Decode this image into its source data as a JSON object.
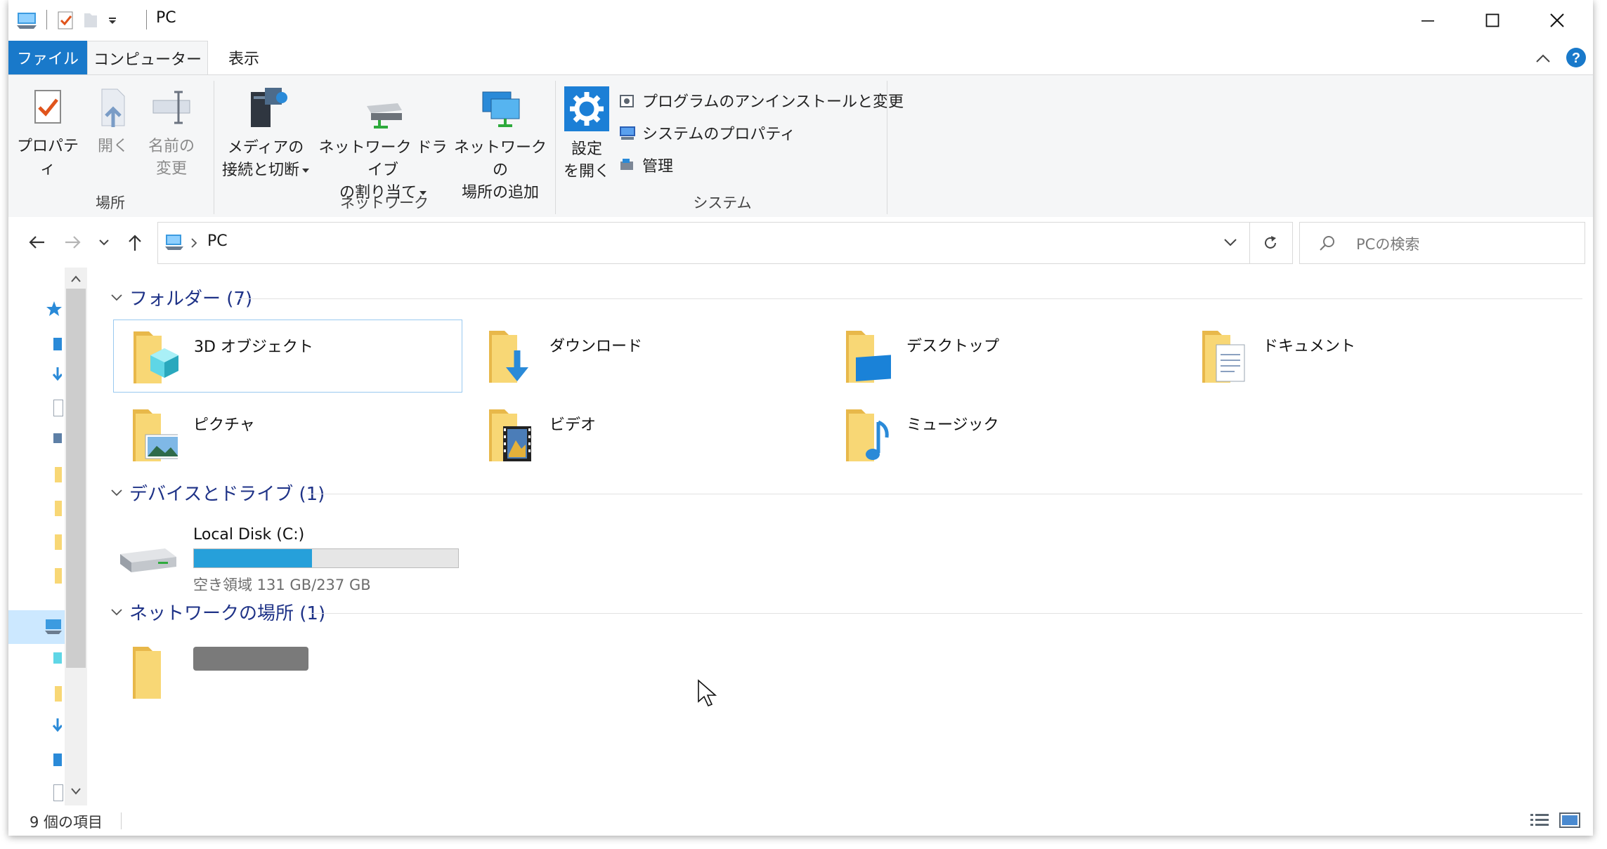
{
  "window": {
    "title": "PC"
  },
  "tabs": {
    "file": "ファイル",
    "computer": "コンピューター",
    "view": "表示"
  },
  "ribbon": {
    "location": {
      "label": "場所",
      "properties": "プロパティ",
      "open": "開く",
      "rename_line1": "名前の",
      "rename_line2": "変更"
    },
    "network": {
      "label": "ネットワーク",
      "media_line1": "メディアの",
      "media_line2": "接続と切断",
      "map_line1": "ネットワーク ドライブ",
      "map_line2": "の割り当て",
      "add_line1": "ネットワークの",
      "add_line2": "場所の追加"
    },
    "system": {
      "label": "システム",
      "settings_line1": "設定",
      "settings_line2": "を開く",
      "uninstall": "プログラムのアンインストールと変更",
      "sys_props": "システムのプロパティ",
      "manage": "管理"
    }
  },
  "address": {
    "path": "PC",
    "search_placeholder": "PCの検索"
  },
  "groups": {
    "folders": {
      "header": "フォルダー (7)",
      "items": [
        "3D オブジェクト",
        "ダウンロード",
        "デスクトップ",
        "ドキュメント",
        "ピクチャ",
        "ビデオ",
        "ミュージック"
      ]
    },
    "devices": {
      "header": "デバイスとドライブ (1)",
      "drive": {
        "name": "Local Disk (C:)",
        "free_text": "空き領域 131 GB/237 GB",
        "used_fraction": 0.447
      }
    },
    "network": {
      "header": "ネットワークの場所 (1)"
    }
  },
  "status": {
    "count": "9 個の項目"
  },
  "colors": {
    "accent": "#1979ca",
    "header_text": "#1e3287",
    "drive_bar": "#26a0da",
    "folder": "#f8d775"
  }
}
